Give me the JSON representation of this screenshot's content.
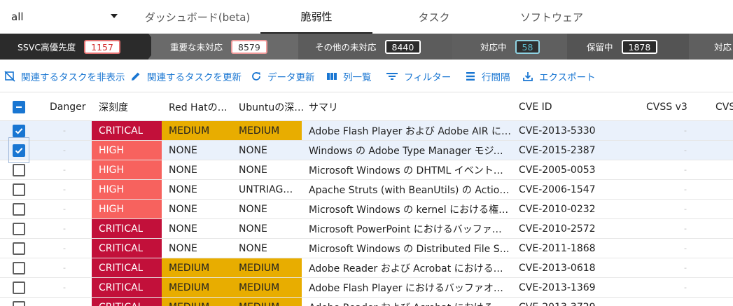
{
  "group_select": {
    "value": "all"
  },
  "tabs": [
    {
      "label": "ダッシュボード(beta)",
      "active": false
    },
    {
      "label": "脆弱性",
      "active": true
    },
    {
      "label": "タスク",
      "active": false
    },
    {
      "label": "ソフトウェア",
      "active": false
    }
  ],
  "pipeline": [
    {
      "label": "SSVC高優先度",
      "count": "1157"
    },
    {
      "label": "重要な未対応",
      "count": "8579"
    },
    {
      "label": "その他の未対応",
      "count": "8440"
    },
    {
      "label": "対応中",
      "count": "58"
    },
    {
      "label": "保留中",
      "count": "1878"
    },
    {
      "label": "対応"
    }
  ],
  "toolbar": {
    "hide_related": "関連するタスクを非表示",
    "update_related": "関連するタスクを更新",
    "refresh": "データ更新",
    "columns": "列一覧",
    "filter": "フィルター",
    "density": "行間隔",
    "export": "エクスポート"
  },
  "table": {
    "headers": {
      "danger": "Danger",
      "severity": "深刻度",
      "redhat": "Red Hatの…",
      "ubuntu": "Ubuntuの深…",
      "summary": "サマリ",
      "cve": "CVE ID",
      "cvss3": "CVSS v3",
      "cvss": "CVS"
    },
    "empty_marker": "-",
    "rows": [
      {
        "checked": true,
        "severity": "CRITICAL",
        "redhat": "MEDIUM",
        "ubuntu": "MEDIUM",
        "summary": "Adobe Flash Player および Adobe AIR に…",
        "cve": "CVE-2013-5330"
      },
      {
        "checked": true,
        "severity": "HIGH",
        "redhat": "NONE",
        "ubuntu": "NONE",
        "summary": "Windows の Adobe Type Manager モジュ…",
        "cve": "CVE-2015-2387"
      },
      {
        "checked": false,
        "severity": "HIGH",
        "redhat": "NONE",
        "ubuntu": "NONE",
        "summary": "Microsoft Windows の DHTML イベントの…",
        "cve": "CVE-2005-0053"
      },
      {
        "checked": false,
        "severity": "HIGH",
        "redhat": "NONE",
        "ubuntu": "UNTRIAG…",
        "summary": "Apache Struts (with BeanUtils) の ActionF…",
        "cve": "CVE-2006-1547"
      },
      {
        "checked": false,
        "severity": "HIGH",
        "redhat": "NONE",
        "ubuntu": "NONE",
        "summary": "Microsoft Windows の kernel における権…",
        "cve": "CVE-2010-0232"
      },
      {
        "checked": false,
        "severity": "CRITICAL",
        "redhat": "NONE",
        "ubuntu": "NONE",
        "summary": "Microsoft PowerPoint におけるバッファ…",
        "cve": "CVE-2010-2572"
      },
      {
        "checked": false,
        "severity": "CRITICAL",
        "redhat": "NONE",
        "ubuntu": "NONE",
        "summary": "Microsoft Windows の Distributed File Sys…",
        "cve": "CVE-2011-1868"
      },
      {
        "checked": false,
        "severity": "CRITICAL",
        "redhat": "MEDIUM",
        "ubuntu": "MEDIUM",
        "summary": "Adobe Reader および Acrobat における…",
        "cve": "CVE-2013-0618"
      },
      {
        "checked": false,
        "severity": "CRITICAL",
        "redhat": "MEDIUM",
        "ubuntu": "MEDIUM",
        "summary": "Adobe Flash Player におけるバッファオ…",
        "cve": "CVE-2013-1369"
      },
      {
        "checked": false,
        "severity": "CRITICAL",
        "redhat": "MEDIUM",
        "ubuntu": "MEDIUM",
        "summary": "Adobe Reader および Acrobat における…",
        "cve": "CVE-2013-3729"
      }
    ]
  },
  "colors": {
    "accent": "#1976d2",
    "critical": "#c2103a",
    "high": "#f7625e",
    "medium": "#e8ad00",
    "pipeline_active": "#2b2b2b",
    "pipeline_bg": "#6a6a6a"
  }
}
